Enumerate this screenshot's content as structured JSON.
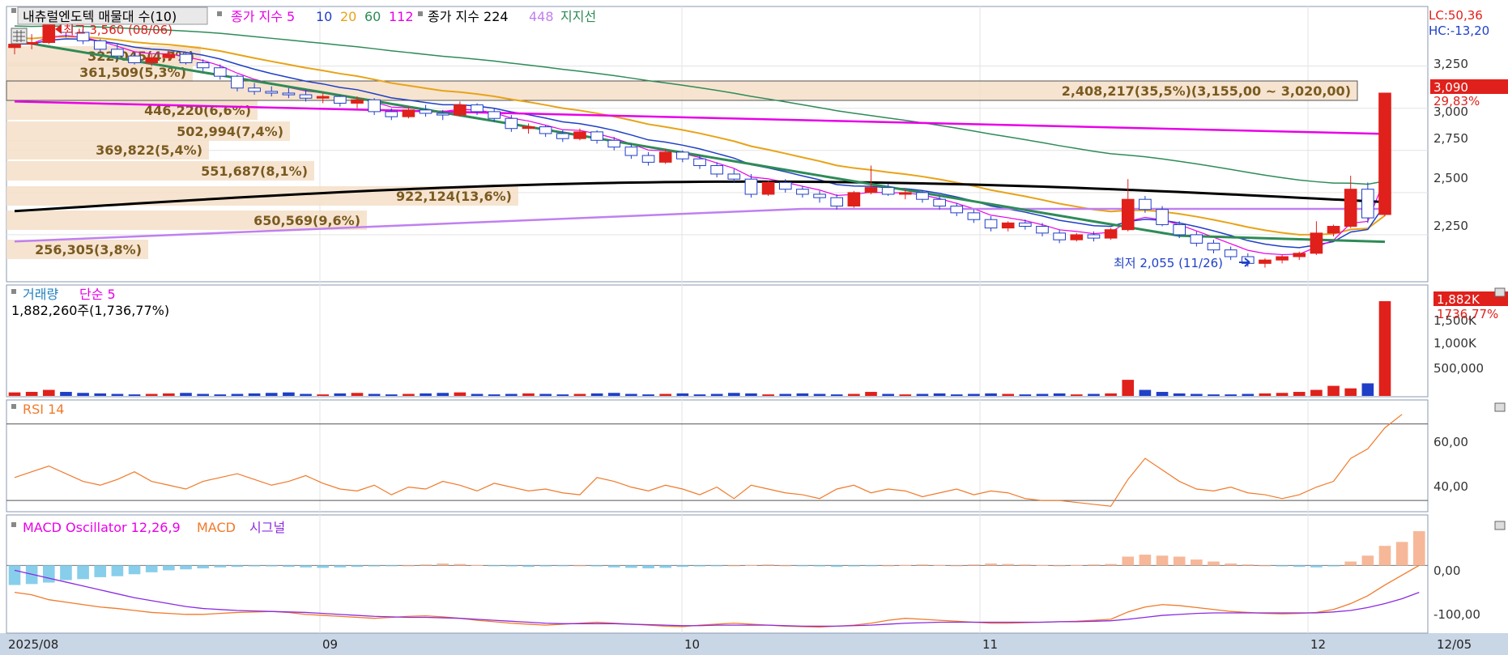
{
  "legend": {
    "title": "내츄럴엔도텍 매물대 수(10)",
    "ma_label": "종가 지수 5",
    "ma_periods": [
      {
        "label": "10",
        "color": "#1f3fc7"
      },
      {
        "label": "20",
        "color": "#e8a317"
      },
      {
        "label": "60",
        "color": "#2e8b57"
      },
      {
        "label": "112",
        "color": "#e800e8"
      }
    ],
    "ma_first_color": "#e800e8",
    "ma2_label": "종가 지수 224",
    "ma2_period_448": "448",
    "support_label": "지지선"
  },
  "corner": {
    "lc": "LC:50,36",
    "hc": "HC:-13,20"
  },
  "price_axis": {
    "ticks": [
      "3,250",
      "3,000",
      "2,750",
      "2,500",
      "2,250"
    ],
    "current": "3,090",
    "change": "29,83%"
  },
  "markers": {
    "high": "최고 3,560 (08/06)",
    "low": "최저 2,055 (11/26)"
  },
  "volume_profile": [
    {
      "label": "322,045(4,7%)"
    },
    {
      "label": "361,509(5,3%)"
    },
    {
      "label": "2,408,217(35,5%)(3,155,00 ~ 3,020,00)"
    },
    {
      "label": "446,220(6,6%)"
    },
    {
      "label": "502,994(7,4%)"
    },
    {
      "label": "369,822(5,4%)"
    },
    {
      "label": "551,687(8,1%)"
    },
    {
      "label": "922,124(13,6%)"
    },
    {
      "label": "650,569(9,6%)"
    },
    {
      "label": "256,305(3,8%)"
    }
  ],
  "volume_panel": {
    "title": "거래량",
    "ma": "단순 5",
    "value_line": "1,882,260주(1,736,77%)",
    "ticks": [
      "1,500K",
      "1,000K",
      "500,000"
    ],
    "current": "1,882K",
    "change": "1736,77%"
  },
  "rsi_panel": {
    "title": "RSI 14",
    "ticks": [
      "60,00",
      "40,00"
    ]
  },
  "macd_panel": {
    "title": "MACD Oscillator 12,26,9",
    "macd": "MACD",
    "signal": "시그널",
    "ticks": [
      "0,00",
      "-100,00"
    ]
  },
  "x_axis": {
    "labels": [
      "2025/08",
      "09",
      "10",
      "11",
      "12"
    ],
    "end_label": "12/05"
  },
  "colors": {
    "up": "#e0201b",
    "down": "#1f3fc7",
    "ma5": "#e800e8",
    "ma10": "#1f3fc7",
    "ma20": "#e8a317",
    "ma60": "#2e8b57",
    "ma112": "#e800e8",
    "ma224": "#000000",
    "ma448": "#c080f0",
    "rsi": "#f07a2a",
    "macd": "#f07a2a",
    "signal": "#8a2be2",
    "osc": "#87ceeb"
  },
  "chart_data": {
    "type": "candlestick",
    "price_range": [
      2000,
      3450
    ],
    "candles": [
      [
        3360,
        3410,
        3320,
        3380
      ],
      [
        3380,
        3440,
        3350,
        3390
      ],
      [
        3390,
        3560,
        3380,
        3500
      ],
      [
        3500,
        3520,
        3420,
        3450
      ],
      [
        3450,
        3470,
        3380,
        3400
      ],
      [
        3400,
        3410,
        3330,
        3350
      ],
      [
        3350,
        3380,
        3290,
        3310
      ],
      [
        3310,
        3330,
        3260,
        3270
      ],
      [
        3270,
        3320,
        3250,
        3300
      ],
      [
        3300,
        3340,
        3280,
        3320
      ],
      [
        3320,
        3330,
        3260,
        3270
      ],
      [
        3270,
        3290,
        3220,
        3240
      ],
      [
        3240,
        3260,
        3170,
        3190
      ],
      [
        3190,
        3200,
        3100,
        3120
      ],
      [
        3120,
        3150,
        3080,
        3100
      ],
      [
        3100,
        3130,
        3070,
        3090
      ],
      [
        3090,
        3120,
        3060,
        3080
      ],
      [
        3080,
        3110,
        3040,
        3060
      ],
      [
        3060,
        3090,
        3030,
        3070
      ],
      [
        3070,
        3080,
        3010,
        3030
      ],
      [
        3030,
        3070,
        3000,
        3050
      ],
      [
        3050,
        3060,
        2960,
        2980
      ],
      [
        2980,
        3000,
        2930,
        2950
      ],
      [
        2950,
        3010,
        2940,
        2990
      ],
      [
        2990,
        3020,
        2950,
        2970
      ],
      [
        2970,
        2990,
        2930,
        2960
      ],
      [
        2960,
        3040,
        2950,
        3020
      ],
      [
        3020,
        3030,
        2960,
        2980
      ],
      [
        2980,
        3000,
        2920,
        2940
      ],
      [
        2940,
        2960,
        2860,
        2880
      ],
      [
        2880,
        2910,
        2850,
        2890
      ],
      [
        2890,
        2900,
        2830,
        2850
      ],
      [
        2850,
        2870,
        2800,
        2820
      ],
      [
        2820,
        2880,
        2810,
        2860
      ],
      [
        2860,
        2870,
        2790,
        2810
      ],
      [
        2810,
        2830,
        2750,
        2770
      ],
      [
        2770,
        2790,
        2700,
        2720
      ],
      [
        2720,
        2740,
        2660,
        2680
      ],
      [
        2680,
        2760,
        2670,
        2740
      ],
      [
        2740,
        2750,
        2680,
        2700
      ],
      [
        2700,
        2720,
        2640,
        2660
      ],
      [
        2660,
        2680,
        2590,
        2610
      ],
      [
        2610,
        2640,
        2560,
        2580
      ],
      [
        2580,
        2610,
        2470,
        2490
      ],
      [
        2490,
        2570,
        2480,
        2560
      ],
      [
        2560,
        2580,
        2500,
        2520
      ],
      [
        2520,
        2540,
        2470,
        2490
      ],
      [
        2490,
        2510,
        2440,
        2470
      ],
      [
        2470,
        2490,
        2400,
        2420
      ],
      [
        2420,
        2510,
        2410,
        2500
      ],
      [
        2500,
        2660,
        2490,
        2530
      ],
      [
        2530,
        2550,
        2480,
        2490
      ],
      [
        2490,
        2520,
        2460,
        2500
      ],
      [
        2500,
        2510,
        2440,
        2460
      ],
      [
        2460,
        2480,
        2400,
        2420
      ],
      [
        2420,
        2440,
        2360,
        2380
      ],
      [
        2380,
        2400,
        2320,
        2340
      ],
      [
        2340,
        2360,
        2270,
        2290
      ],
      [
        2290,
        2330,
        2270,
        2320
      ],
      [
        2320,
        2340,
        2280,
        2300
      ],
      [
        2300,
        2320,
        2240,
        2260
      ],
      [
        2260,
        2280,
        2200,
        2220
      ],
      [
        2220,
        2260,
        2210,
        2250
      ],
      [
        2250,
        2270,
        2210,
        2230
      ],
      [
        2230,
        2290,
        2220,
        2280
      ],
      [
        2280,
        2580,
        2270,
        2460
      ],
      [
        2460,
        2480,
        2380,
        2400
      ],
      [
        2400,
        2420,
        2300,
        2310
      ],
      [
        2310,
        2330,
        2230,
        2250
      ],
      [
        2250,
        2270,
        2180,
        2200
      ],
      [
        2200,
        2220,
        2140,
        2160
      ],
      [
        2160,
        2180,
        2100,
        2120
      ],
      [
        2120,
        2140,
        2060,
        2080
      ],
      [
        2080,
        2110,
        2055,
        2100
      ],
      [
        2100,
        2130,
        2080,
        2120
      ],
      [
        2120,
        2150,
        2100,
        2140
      ],
      [
        2140,
        2330,
        2130,
        2260
      ],
      [
        2260,
        2310,
        2240,
        2300
      ],
      [
        2300,
        2600,
        2290,
        2520
      ],
      [
        2520,
        2560,
        2320,
        2350
      ],
      [
        2370,
        3090,
        2360,
        3090
      ]
    ],
    "volume": [
      70,
      80,
      120,
      80,
      60,
      50,
      40,
      30,
      40,
      50,
      60,
      40,
      30,
      40,
      50,
      60,
      70,
      40,
      30,
      50,
      60,
      40,
      30,
      40,
      50,
      60,
      70,
      40,
      30,
      40,
      50,
      40,
      30,
      40,
      50,
      60,
      40,
      30,
      40,
      50,
      30,
      40,
      60,
      50,
      30,
      40,
      50,
      40,
      30,
      40,
      80,
      40,
      30,
      40,
      50,
      30,
      40,
      50,
      40,
      30,
      40,
      50,
      30,
      40,
      50,
      320,
      120,
      80,
      50,
      40,
      30,
      30,
      40,
      50,
      60,
      80,
      120,
      200,
      150,
      250,
      1882
    ],
    "rsi": [
      42,
      45,
      48,
      44,
      40,
      38,
      41,
      45,
      40,
      38,
      36,
      40,
      42,
      44,
      41,
      38,
      40,
      43,
      39,
      36,
      35,
      38,
      33,
      37,
      36,
      40,
      38,
      35,
      39,
      37,
      35,
      36,
      34,
      33,
      42,
      40,
      37,
      35,
      38,
      36,
      33,
      37,
      31,
      38,
      36,
      34,
      33,
      31,
      36,
      38,
      34,
      36,
      35,
      32,
      34,
      36,
      33,
      35,
      34,
      31,
      30,
      30,
      29,
      28,
      27,
      41,
      52,
      46,
      40,
      36,
      35,
      37,
      34,
      33,
      31,
      33,
      37,
      40,
      52,
      57,
      68,
      75
    ],
    "macd_osc": [
      -40,
      -38,
      -35,
      -30,
      -28,
      -24,
      -22,
      -18,
      -14,
      -10,
      -8,
      -6,
      -4,
      -3,
      -2,
      -2,
      -3,
      -4,
      -5,
      -4,
      -3,
      -2,
      -1,
      0,
      2,
      4,
      3,
      1,
      -1,
      -2,
      -3,
      -2,
      -1,
      0,
      -2,
      -4,
      -5,
      -6,
      -5,
      -3,
      -2,
      -1,
      0,
      1,
      2,
      0,
      -1,
      -2,
      -3,
      -2,
      -1,
      0,
      1,
      2,
      1,
      0,
      2,
      4,
      3,
      2,
      1,
      0,
      1,
      2,
      3,
      18,
      22,
      20,
      18,
      12,
      8,
      4,
      2,
      0,
      -2,
      -3,
      -4,
      -2,
      8,
      20,
      40,
      48,
      70
    ],
    "macd_line": [
      -55,
      -60,
      -70,
      -75,
      -80,
      -85,
      -88,
      -92,
      -96,
      -98,
      -100,
      -100,
      -98,
      -96,
      -95,
      -94,
      -96,
      -100,
      -102,
      -104,
      -106,
      -108,
      -106,
      -104,
      -103,
      -105,
      -108,
      -112,
      -115,
      -118,
      -120,
      -122,
      -120,
      -118,
      -116,
      -118,
      -120,
      -122,
      -124,
      -125,
      -122,
      -120,
      -118,
      -120,
      -122,
      -124,
      -125,
      -126,
      -124,
      -122,
      -118,
      -112,
      -108,
      -110,
      -112,
      -114,
      -116,
      -118,
      -118,
      -117,
      -116,
      -115,
      -114,
      -112,
      -110,
      -95,
      -85,
      -80,
      -82,
      -86,
      -90,
      -94,
      -96,
      -98,
      -99,
      -98,
      -96,
      -90,
      -78,
      -62,
      -40,
      -20,
      0
    ],
    "signal_line": [
      -10,
      -18,
      -26,
      -34,
      -42,
      -50,
      -58,
      -66,
      -72,
      -78,
      -84,
      -88,
      -90,
      -92,
      -93,
      -94,
      -95,
      -96,
      -98,
      -100,
      -102,
      -104,
      -105,
      -106,
      -106,
      -107,
      -108,
      -110,
      -112,
      -114,
      -116,
      -118,
      -119,
      -119,
      -119,
      -119,
      -120,
      -121,
      -122,
      -123,
      -123,
      -122,
      -122,
      -122,
      -122,
      -123,
      -124,
      -124,
      -124,
      -123,
      -122,
      -120,
      -118,
      -117,
      -116,
      -116,
      -116,
      -116,
      -116,
      -116,
      -116,
      -115,
      -115,
      -114,
      -113,
      -110,
      -106,
      -102,
      -100,
      -98,
      -97,
      -97,
      -97,
      -97,
      -97,
      -97,
      -97,
      -95,
      -92,
      -86,
      -78,
      -68,
      -55
    ]
  }
}
